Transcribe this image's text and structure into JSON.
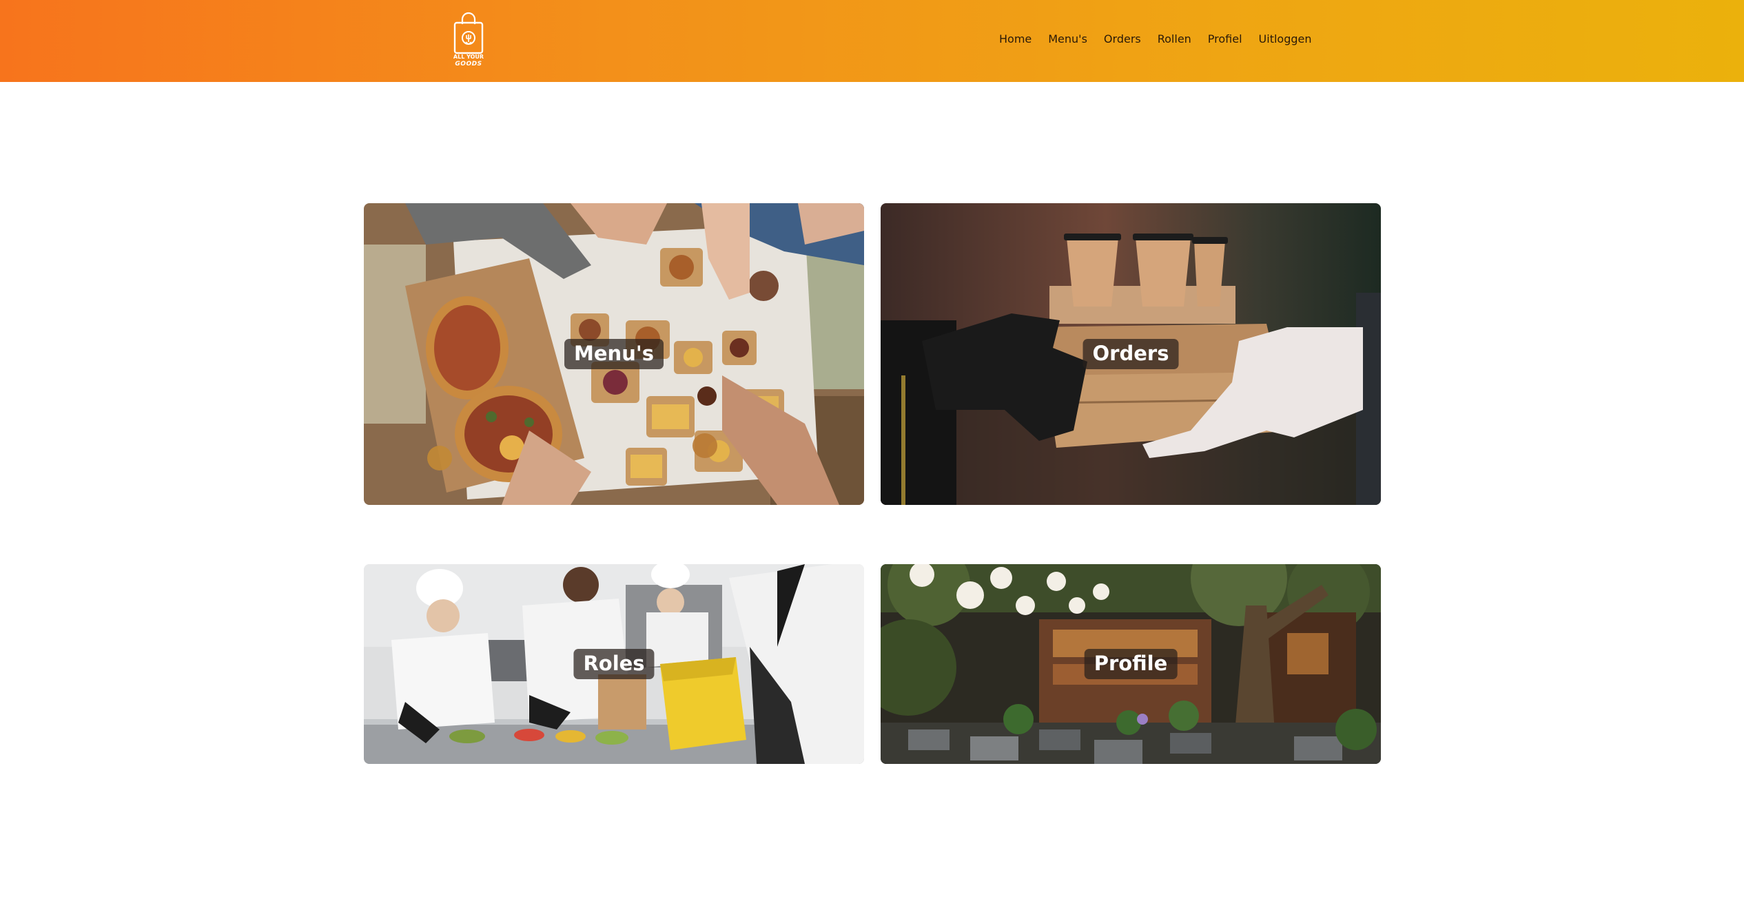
{
  "brand": {
    "logo_line1": "ALL YOUR",
    "logo_line2": "GOODS"
  },
  "nav": {
    "items": [
      {
        "label": "Home"
      },
      {
        "label": "Menu's"
      },
      {
        "label": "Orders"
      },
      {
        "label": "Rollen"
      },
      {
        "label": "Profiel"
      },
      {
        "label": "Uitloggen"
      }
    ]
  },
  "cards": [
    {
      "label": "Menu's",
      "image": "food-table-photo"
    },
    {
      "label": "Orders",
      "image": "delivery-handover-photo"
    },
    {
      "label": "Roles",
      "image": "kitchen-staff-photo"
    },
    {
      "label": "Profile",
      "image": "restaurant-terrace-photo"
    }
  ],
  "colors": {
    "header_gradient_start": "#f7741c",
    "header_gradient_end": "#ebb10c",
    "label_background": "#28201c"
  }
}
